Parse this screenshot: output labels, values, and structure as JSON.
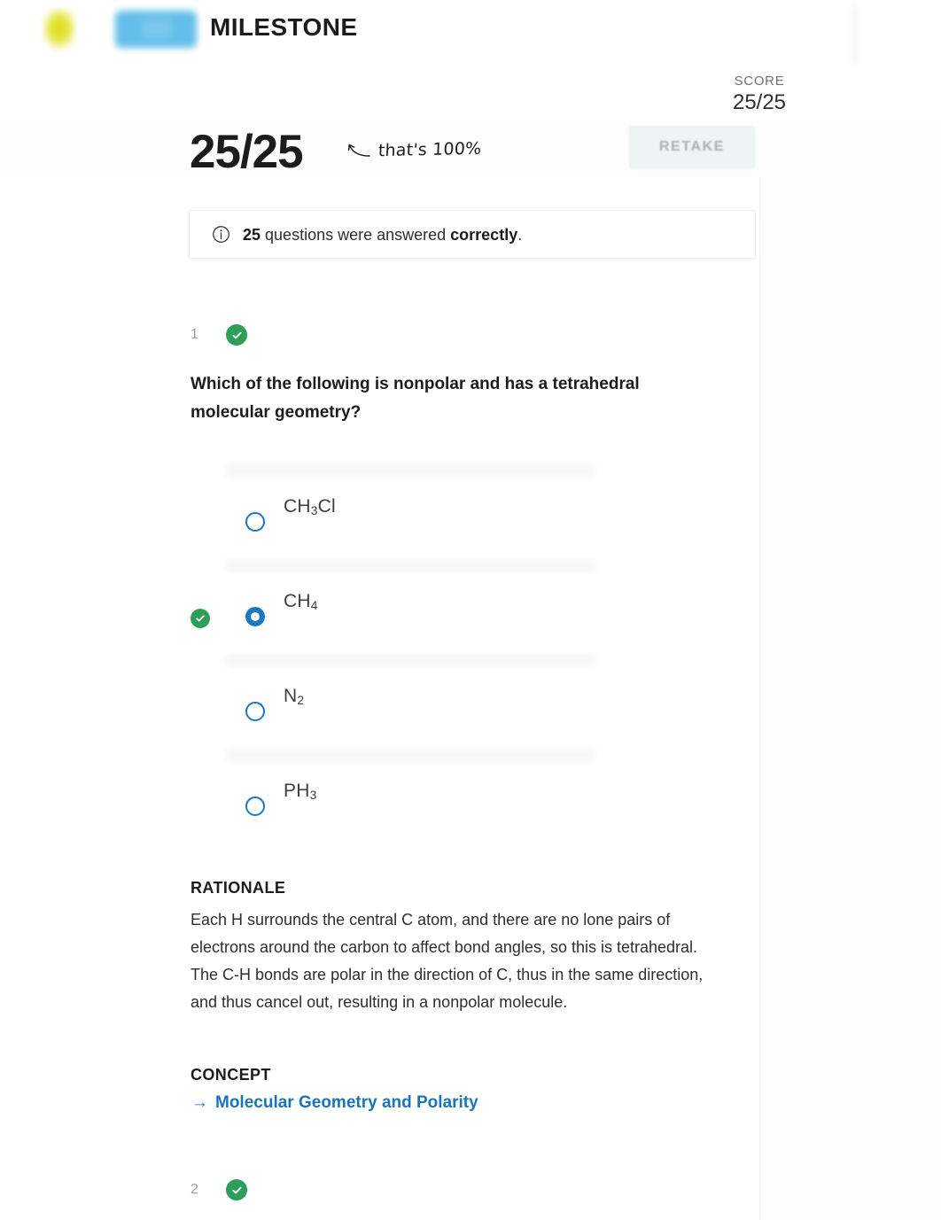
{
  "header": {
    "brand_title": "MILESTONE",
    "logo_mark_icon": "leaf-blob-icon",
    "logo_redacted_icon": "redacted-logo-block"
  },
  "score_panel": {
    "label": "SCORE",
    "value": "25/25"
  },
  "result": {
    "big_score": "25/25",
    "hand_note": "that's 100%",
    "hand_arrow_icon": "curved-left-arrow-icon",
    "retake_label": "RETAKE"
  },
  "info_banner": {
    "icon": "info-circle-icon",
    "count": "25",
    "text_middle": " questions were answered ",
    "emphasis": "correctly",
    "text_end": "."
  },
  "questions": [
    {
      "number": "1",
      "status_icon": "green-check-icon",
      "prompt": "Which of the following is nonpolar and has a tetrahedral molecular geometry?",
      "options": [
        {
          "label_html": "CH<sub>3</sub>Cl",
          "selected": false,
          "correct": false
        },
        {
          "label_html": "CH<sub>4</sub>",
          "selected": true,
          "correct": true
        },
        {
          "label_html": "N<sub>2</sub>",
          "selected": false,
          "correct": false
        },
        {
          "label_html": "PH<sub>3</sub>",
          "selected": false,
          "correct": false
        }
      ],
      "rationale_heading": "RATIONALE",
      "rationale": "Each H surrounds the central C atom, and there are no lone pairs of electrons around the carbon to affect bond angles, so this is tetrahedral. The C-H bonds are polar in the direction of C, thus in the same direction, and thus cancel out, resulting in a nonpolar molecule.",
      "concept_heading": "CONCEPT",
      "concept_link": "Molecular Geometry and Polarity",
      "concept_arrow": "→"
    },
    {
      "number": "2",
      "status_icon": "green-check-icon"
    }
  ],
  "colors": {
    "accent_blue": "#1b77c0",
    "link_blue": "#1a73bd",
    "correct_green": "#2e9e5b",
    "text_dark": "#1c1c1c",
    "text_body": "#2b2f31",
    "muted": "#9aa0a4",
    "retake_bg": "#eef3f4"
  }
}
